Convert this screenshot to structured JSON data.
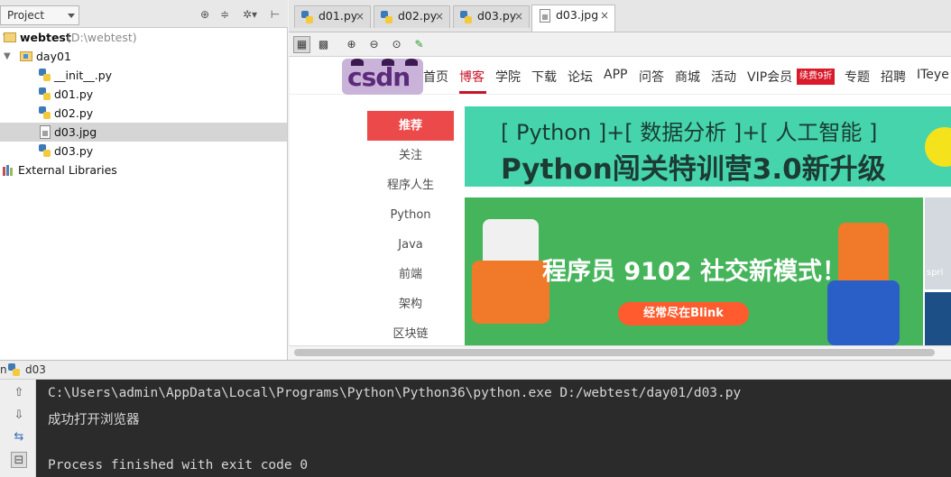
{
  "project_panel": {
    "combo_label": "Project",
    "header_icons": [
      "target-icon",
      "collapse-icon",
      "gear-icon",
      "pin-icon"
    ],
    "tree": [
      {
        "label": "webtest",
        "path": "(D:\\webtest)",
        "type": "folder",
        "depth": 0,
        "expanded": true
      },
      {
        "label": "day01",
        "type": "package",
        "depth": 1,
        "expanded": true
      },
      {
        "label": "__init__.py",
        "type": "python",
        "depth": 2
      },
      {
        "label": "d01.py",
        "type": "python",
        "depth": 2
      },
      {
        "label": "d02.py",
        "type": "python",
        "depth": 2
      },
      {
        "label": "d03.jpg",
        "type": "image",
        "depth": 2,
        "selected": true
      },
      {
        "label": "d03.py",
        "type": "python",
        "depth": 2
      },
      {
        "label": "External Libraries",
        "type": "library",
        "depth": 0
      }
    ]
  },
  "editor": {
    "tabs": [
      {
        "label": "d01.py",
        "type": "python",
        "active": false
      },
      {
        "label": "d02.py",
        "type": "python",
        "active": false
      },
      {
        "label": "d03.py",
        "type": "python",
        "active": false
      },
      {
        "label": "d03.jpg",
        "type": "image",
        "active": true
      }
    ],
    "close_glyph": "×",
    "viewer_tools": [
      "grid-toggle-icon",
      "chessboard-icon",
      "zoom-in-icon",
      "zoom-out-icon",
      "actual-size-icon",
      "color-picker-icon"
    ]
  },
  "image_content": {
    "logo_text": "csdn",
    "nav": [
      "首页",
      "博客",
      "学院",
      "下载",
      "论坛",
      "APP",
      "问答",
      "商城",
      "活动",
      "VIP会员",
      "专题",
      "招聘",
      "ITeye"
    ],
    "vip_badge": "续费9折",
    "side_menu": [
      "推荐",
      "关注",
      "程序人生",
      "Python",
      "Java",
      "前端",
      "架构",
      "区块链"
    ],
    "banner1_top": "[ Python ]+[ 数据分析 ]+[ 人工智能 ]",
    "banner1_main": "Python闯关特训营3.0新升级",
    "banner2_title": "程序员 9102 社交新模式！",
    "banner2_button": "经常尽在Blink",
    "thumb_text": "spri",
    "colors": {
      "brand_red": "#c7152b",
      "banner1_bg": "#46d4ac",
      "banner2_bg": "#46b45a",
      "button_orange": "#ff5b2e"
    }
  },
  "run_panel": {
    "prefix": "n",
    "config_name": "d03",
    "console_lines": [
      "C:\\Users\\admin\\AppData\\Local\\Programs\\Python\\Python36\\python.exe D:/webtest/day01/d03.py",
      "成功打开浏览器",
      "",
      "Process finished with exit code 0"
    ]
  }
}
